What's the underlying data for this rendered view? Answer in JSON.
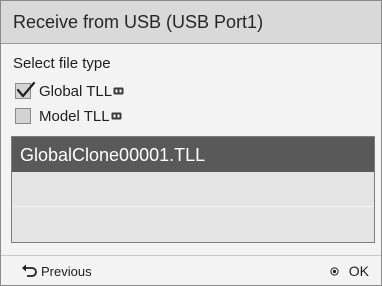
{
  "dialog": {
    "title": "Receive from USB (USB Port1)",
    "section_label": "Select file type"
  },
  "file_types": [
    {
      "label": "Global TLL",
      "checked": true,
      "icon": "usb-icon"
    },
    {
      "label": "Model TLL",
      "checked": false,
      "icon": "usb-icon"
    }
  ],
  "file_list": [
    {
      "name": "GlobalClone00001.TLL",
      "selected": true
    },
    {
      "name": "",
      "selected": false
    },
    {
      "name": "",
      "selected": false
    }
  ],
  "footer": {
    "previous_label": "Previous",
    "previous_icon": "return-arrow-icon",
    "ok_label": "OK",
    "ok_icon": "ok-dot-icon"
  },
  "colors": {
    "title_bar": "#d9d9d9",
    "selection": "#595959",
    "background": "#f3f3f3"
  }
}
